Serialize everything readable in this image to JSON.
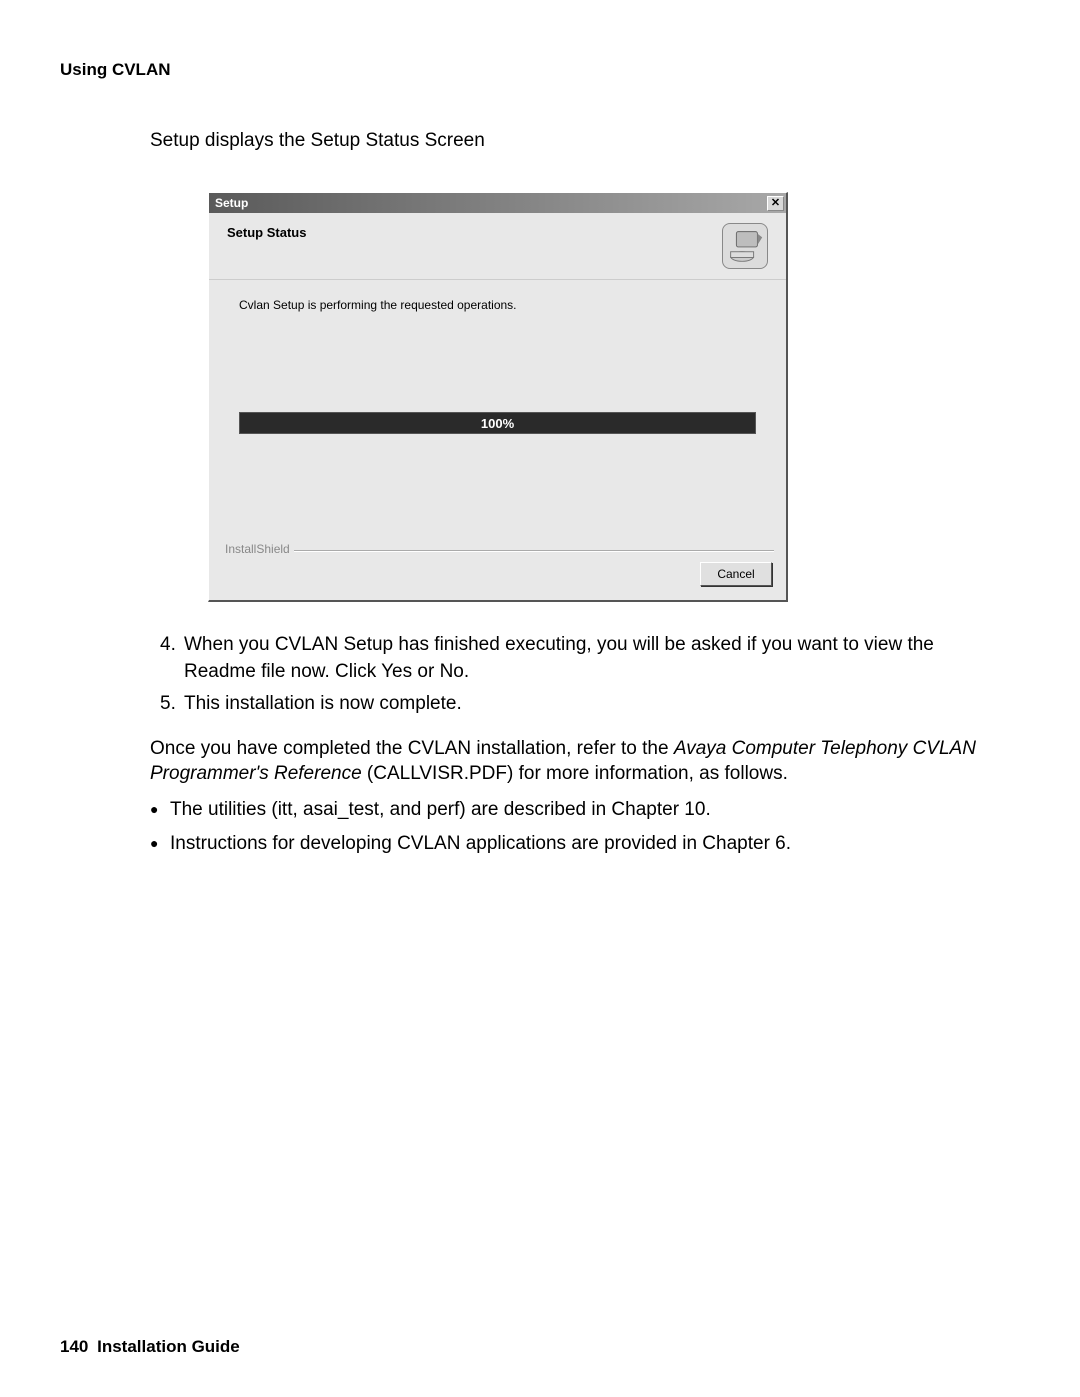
{
  "section_header": "Using CVLAN",
  "intro": "Setup displays the Setup Status Screen",
  "dialog": {
    "title": "Setup",
    "header_title": "Setup Status",
    "status_text": "Cvlan Setup is performing the requested operations.",
    "progress_label": "100%",
    "fieldset_label": "InstallShield",
    "cancel_label": "Cancel",
    "close_symbol": "✕"
  },
  "steps": {
    "s4_num": "4.",
    "s4_text": "When you CVLAN Setup has finished executing, you will be asked if you want to view the Readme file now. Click Yes or No.",
    "s5_num": "5.",
    "s5_text": "This installation is now complete."
  },
  "paragraph": {
    "pre": "Once you have completed the CVLAN installation, refer to the ",
    "italic": "Avaya Computer Telephony CVLAN Programmer's Reference",
    "post": " (CALLVISR.PDF) for more information, as follows."
  },
  "bullets": {
    "b1": "The utilities (itt, asai_test, and perf) are described in Chapter 10.",
    "b2": "Instructions for developing CVLAN applications are provided in Chapter 6."
  },
  "footer": {
    "page": "140",
    "guide": "Installation Guide"
  }
}
